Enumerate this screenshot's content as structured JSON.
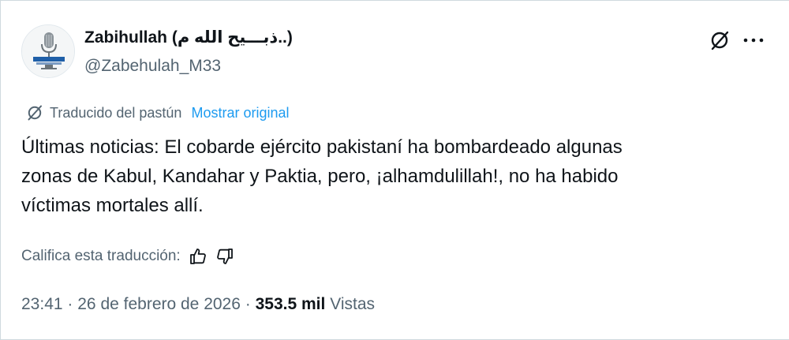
{
  "author": {
    "display_name": "Zabihullah (ذبـــیح الله م..)",
    "handle": "@Zabehulah_M33"
  },
  "icons": {
    "header_translate": "grok-translate-icon",
    "more": "more-horizontal-icon",
    "translate_notice": "translate-icon",
    "thumbs_up": "thumbs-up-icon",
    "thumbs_down": "thumbs-down-icon"
  },
  "translation": {
    "label": "Traducido del pastún",
    "show_original": "Mostrar original"
  },
  "post": {
    "lines": [
      "Últimas noticias: El cobarde ejército pakistaní ha bombardeado algunas",
      "zonas de Kabul, Kandahar y Paktia, pero, ¡alhamdulillah!, no ha habido",
      "víctimas mortales allí."
    ]
  },
  "rating": {
    "prompt": "Califica esta traducción:"
  },
  "meta": {
    "time": "23:41",
    "separator": "·",
    "date": "26 de febrero de 2026",
    "views_count": "353.5 mil",
    "views_label": "Vistas"
  },
  "colors": {
    "text_primary": "#0f1419",
    "text_secondary": "#536471",
    "link": "#1d9bf0",
    "border": "#cfd9de"
  }
}
